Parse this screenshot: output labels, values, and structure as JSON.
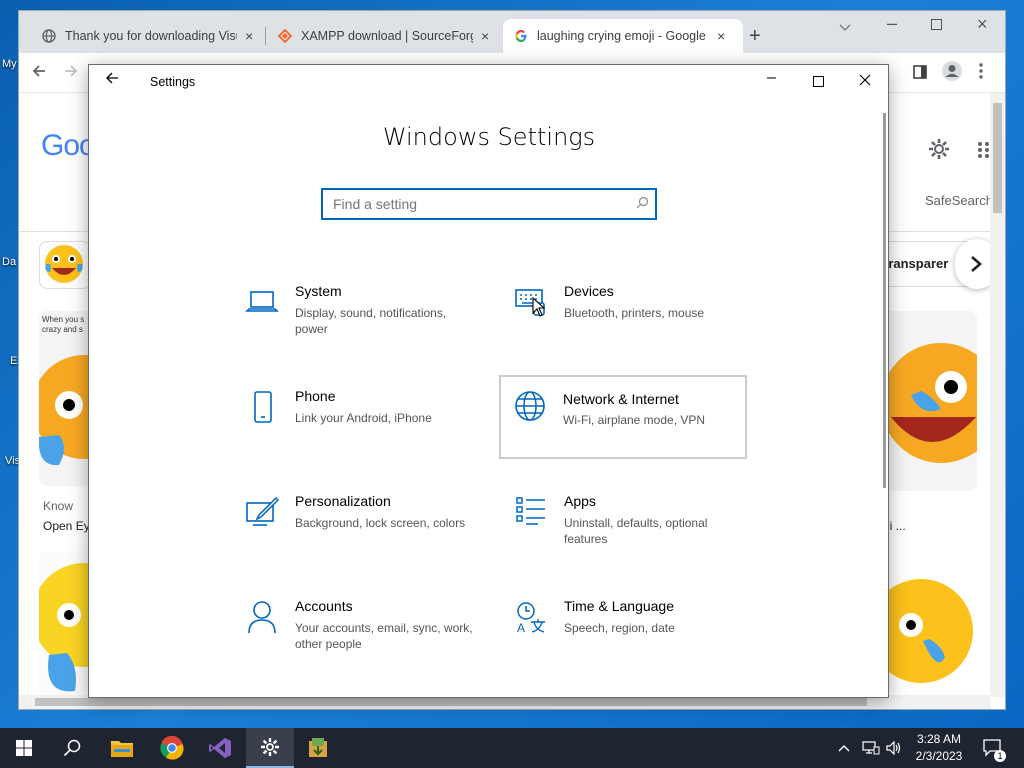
{
  "desktop": {
    "labels": [
      "My",
      "Da",
      "E",
      "Vis"
    ]
  },
  "chrome": {
    "tabs": [
      {
        "title": "Thank you for downloading Visu",
        "icon": "globe-icon"
      },
      {
        "title": "XAMPP download | SourceForge.",
        "icon": "sourceforge-icon"
      },
      {
        "title": "laughing crying emoji - Google",
        "icon": "google-icon"
      }
    ],
    "new_tab": "+",
    "close": "×",
    "page": {
      "google_logo": "Goo",
      "safesearch": "SafeSearch",
      "chip": "transparer",
      "left_card_caption": "When you s crazy and s",
      "know_label": "Know",
      "open_label": "Open Ey",
      "right_caption": "ji ..."
    }
  },
  "settings": {
    "title": "Settings",
    "heading": "Windows Settings",
    "search_placeholder": "Find a setting",
    "categories": [
      {
        "name": "System",
        "desc": "Display, sound, notifications, power",
        "icon": "laptop-icon"
      },
      {
        "name": "Devices",
        "desc": "Bluetooth, printers, mouse",
        "icon": "keyboard-icon"
      },
      {
        "name": "Phone",
        "desc": "Link your Android, iPhone",
        "icon": "phone-icon"
      },
      {
        "name": "Network & Internet",
        "desc": "Wi-Fi, airplane mode, VPN",
        "icon": "globe-icon"
      },
      {
        "name": "Personalization",
        "desc": "Background, lock screen, colors",
        "icon": "paint-icon"
      },
      {
        "name": "Apps",
        "desc": "Uninstall, defaults, optional features",
        "icon": "apps-list-icon"
      },
      {
        "name": "Accounts",
        "desc": "Your accounts, email, sync, work, other people",
        "icon": "person-icon"
      },
      {
        "name": "Time & Language",
        "desc": "Speech, region, date",
        "icon": "time-language-icon"
      }
    ]
  },
  "taskbar": {
    "time": "3:28 AM",
    "date": "2/3/2023",
    "notification_count": "1"
  },
  "colors": {
    "accent": "#0067c0",
    "taskbar": "#1f2530"
  }
}
